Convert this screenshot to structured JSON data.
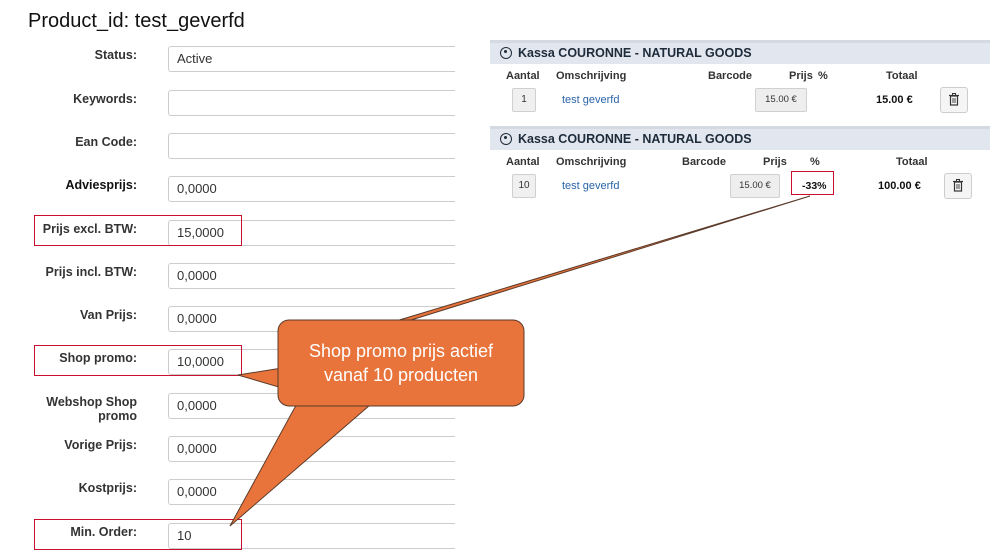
{
  "title": "Product_id: test_geverfd",
  "form": {
    "fields": [
      {
        "label": "Status:",
        "value": "Active"
      },
      {
        "label": "Keywords:",
        "value": ""
      },
      {
        "label": "Ean Code:",
        "value": ""
      },
      {
        "label": "Adviesprijs:",
        "value": "0,0000"
      },
      {
        "label": "Prijs excl. BTW:",
        "value": "15,0000"
      },
      {
        "label": "Prijs incl. BTW:",
        "value": "0,0000"
      },
      {
        "label": "Van Prijs:",
        "value": "0,0000"
      },
      {
        "label": "Shop promo:",
        "value": "10,0000"
      },
      {
        "label": "Webshop Shop promo",
        "value": "0,0000"
      },
      {
        "label": "Vorige Prijs:",
        "value": "0,0000"
      },
      {
        "label": "Kostprijs:",
        "value": "0,0000"
      },
      {
        "label": "Min. Order:",
        "value": "10"
      }
    ]
  },
  "kassa": [
    {
      "title": "Kassa COURONNE - NATURAL GOODS",
      "columns": {
        "aantal": "Aantal",
        "omschrijving": "Omschrijving",
        "barcode": "Barcode",
        "prijs": "Prijs",
        "pct": "%",
        "totaal": "Totaal"
      },
      "row": {
        "qty": "1",
        "desc": "test geverfd",
        "price": "15.00 €",
        "pct": "",
        "total": "15.00 €"
      }
    },
    {
      "title": "Kassa COURONNE - NATURAL GOODS",
      "columns": {
        "aantal": "Aantal",
        "omschrijving": "Omschrijving",
        "barcode": "Barcode",
        "prijs": "Prijs",
        "pct": "%",
        "totaal": "Totaal"
      },
      "row": {
        "qty": "10",
        "desc": "test geverfd",
        "price": "15.00 €",
        "pct": "-33%",
        "total": "100.00 €"
      }
    }
  ],
  "callout": {
    "line1": "Shop promo prijs actief",
    "line2": "vanaf 10 producten"
  },
  "colors": {
    "callout": "#e8743b",
    "highlight": "#c8102e",
    "panel_header": "#e2e6ee"
  }
}
